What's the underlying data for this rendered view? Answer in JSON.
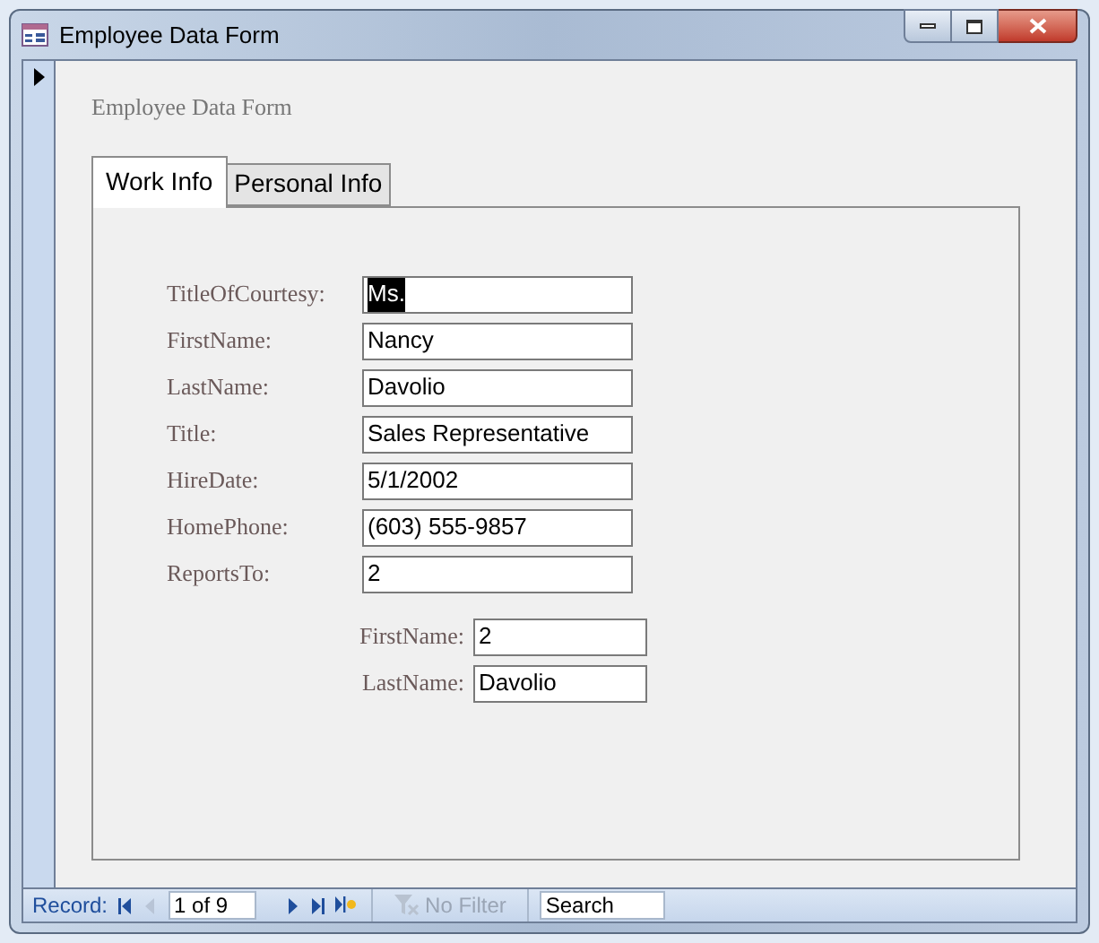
{
  "window": {
    "title": "Employee Data Form"
  },
  "form_title": "Employee Data Form",
  "record_selector": {
    "current": true
  },
  "tabs": [
    {
      "label": "Work Info",
      "selected": true
    },
    {
      "label": "Personal Info",
      "selected": false
    }
  ],
  "fields": [
    {
      "label": "TitleOfCourtesy:",
      "value": "Ms.",
      "selected": true
    },
    {
      "label": "FirstName:",
      "value": "Nancy",
      "selected": false
    },
    {
      "label": "LastName:",
      "value": "Davolio",
      "selected": false
    },
    {
      "label": "Title:",
      "value": "Sales Representative",
      "selected": false
    },
    {
      "label": "HireDate:",
      "value": "5/1/2002",
      "selected": false
    },
    {
      "label": "HomePhone:",
      "value": "(603) 555-9857",
      "selected": false
    },
    {
      "label": "ReportsTo:",
      "value": "2",
      "selected": false
    }
  ],
  "subfields": [
    {
      "label": "FirstName:",
      "value": "2"
    },
    {
      "label": "LastName:",
      "value": "Davolio"
    }
  ],
  "status_bar": {
    "record_label": "Record:",
    "position": "1 of 9",
    "filter": "No Filter",
    "search_placeholder": "Search"
  }
}
